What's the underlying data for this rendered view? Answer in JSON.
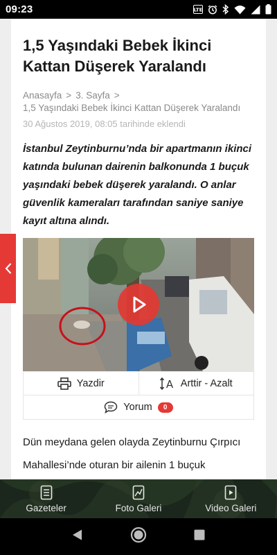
{
  "status_bar": {
    "time": "09:23",
    "icons": [
      "lte-icon",
      "alarm-icon",
      "bluetooth-icon",
      "wifi-icon",
      "signal-icon",
      "battery-icon"
    ]
  },
  "article": {
    "title": "1,5 Yaşındaki Bebek İkinci Kattan Düşerek Yaralandı",
    "breadcrumb": {
      "home": "Anasayfa",
      "section": "3. Sayfa",
      "current": "1,5 Yaşındaki Bebek İkinci Kattan Düşerek Yaralandı",
      "separator": ">"
    },
    "meta": "30 Ağustos 2019, 08:05 tarihinde eklendi",
    "lead": "İstanbul Zeytinburnu’nda bir apartmanın ikinci katında bulunan dairenin balkonunda 1 buçuk yaşındaki bebek düşerek yaralandı. O anlar güvenlik kameraları tarafından saniye saniye kayıt altına alındı.",
    "body": "Dün meydana gelen olayda Zeytinburnu Çırpıcı Mahallesi’nde oturan bir ailenin 1 buçuk"
  },
  "actions": {
    "print_label": "Yazdir",
    "font_label": "Arttir - Azalt",
    "comments_label": "Yorum",
    "comments_count": "0"
  },
  "bottom_nav": {
    "items": [
      {
        "label": "Gazeteler",
        "icon": "newspaper-icon"
      },
      {
        "label": "Foto Galeri",
        "icon": "photo-gallery-icon"
      },
      {
        "label": "Video Galeri",
        "icon": "video-gallery-icon"
      }
    ]
  },
  "colors": {
    "accent": "#e53935",
    "nav_bg": "#1e2a1e",
    "text": "#1a1a1a",
    "muted": "#8a8a8a"
  }
}
